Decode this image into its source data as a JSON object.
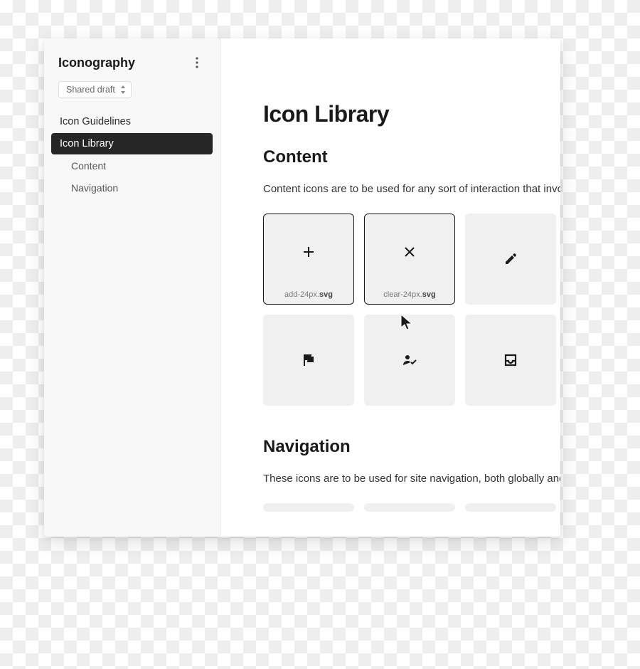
{
  "sidebar": {
    "title": "Iconography",
    "status_label": "Shared draft",
    "nav": [
      {
        "label": "Icon Guidelines",
        "level": 0,
        "active": false
      },
      {
        "label": "Icon Library",
        "level": 0,
        "active": true
      },
      {
        "label": "Content",
        "level": 1,
        "active": false
      },
      {
        "label": "Navigation",
        "level": 1,
        "active": false
      }
    ]
  },
  "main": {
    "page_title": "Icon Library",
    "sections": {
      "content": {
        "title": "Content",
        "description": "Content icons are to be used for any sort of interaction that involve",
        "tiles": [
          {
            "icon": "add-icon",
            "label_base": "add-24px.",
            "label_ext": "svg",
            "hovered": true
          },
          {
            "icon": "clear-icon",
            "label_base": "clear-24px.",
            "label_ext": "svg",
            "hovered": true
          },
          {
            "icon": "edit-icon",
            "label_base": "",
            "label_ext": "",
            "hovered": false
          },
          {
            "icon": "flag-icon",
            "label_base": "",
            "label_ext": "",
            "hovered": false
          },
          {
            "icon": "user-check-icon",
            "label_base": "",
            "label_ext": "",
            "hovered": false
          },
          {
            "icon": "inbox-icon",
            "label_base": "",
            "label_ext": "",
            "hovered": false
          }
        ]
      },
      "navigation": {
        "title": "Navigation",
        "description": "These icons are to be used for site navigation, both globally and wit"
      }
    }
  }
}
